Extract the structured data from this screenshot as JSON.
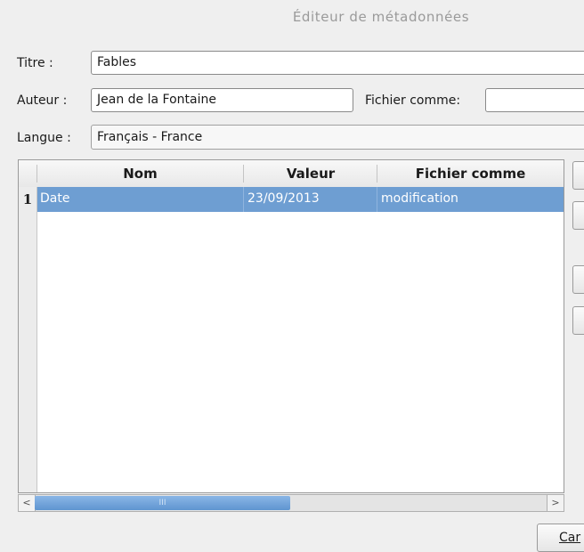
{
  "window": {
    "title": "Éditeur de métadonnées"
  },
  "form": {
    "title_label": "Titre :",
    "title_value": "Fables",
    "author_label": "Auteur :",
    "author_value": "Jean de la Fontaine",
    "file_as_label": "Fichier comme:",
    "file_as_value": "",
    "language_label": "Langue :",
    "language_value": "Français - France"
  },
  "table": {
    "headers": [
      "Nom",
      "Valeur",
      "Fichier comme"
    ],
    "rows": [
      {
        "number": "1",
        "name": "Date",
        "value": "23/09/2013",
        "file_as": "modification",
        "selected": true
      }
    ]
  },
  "scrollbar": {
    "left_arrow": "<",
    "right_arrow": ">",
    "thumb_grip": "III"
  },
  "footer": {
    "cancel_label": "Car"
  }
}
